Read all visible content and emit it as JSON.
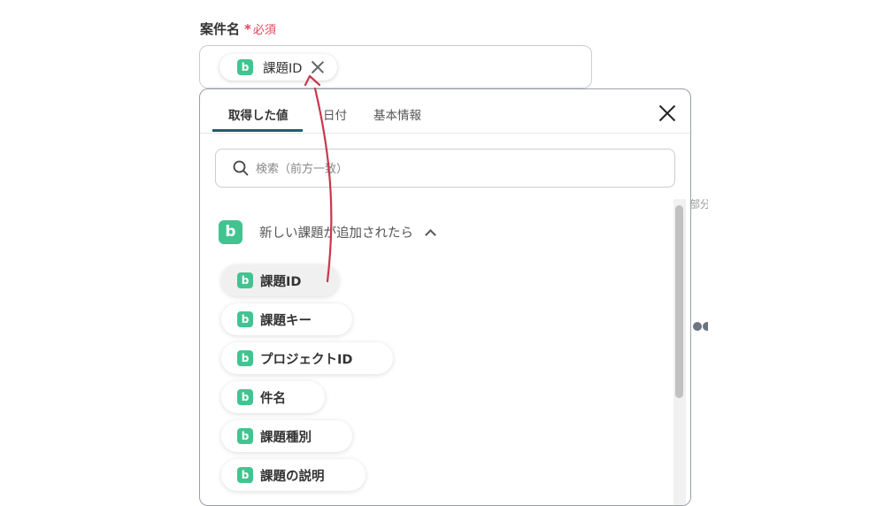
{
  "field": {
    "label": "案件名",
    "required_mark": "*",
    "required_text": "必須",
    "token": {
      "label": "課題ID"
    }
  },
  "side": {
    "partial_text": "部分"
  },
  "popup": {
    "tabs": [
      "取得した値",
      "日付",
      "基本情報"
    ],
    "active_tab": 0,
    "search": {
      "placeholder": "検索（前方一致）",
      "value": ""
    },
    "group": {
      "title": "新しい課題が追加されたら",
      "items": [
        {
          "label": "課題ID",
          "selected": true
        },
        {
          "label": "課題キー"
        },
        {
          "label": "プロジェクトID"
        },
        {
          "label": "件名"
        },
        {
          "label": "課題種別"
        },
        {
          "label": "課題の説明"
        }
      ]
    }
  },
  "icons": {
    "app_icon": "b-app-icon",
    "app_icon_glyph": "b"
  },
  "colors": {
    "accent_green": "#42c490",
    "required_red": "#e0465a",
    "tab_underline": "#1f5f6e",
    "arrow": "#c8384a"
  }
}
